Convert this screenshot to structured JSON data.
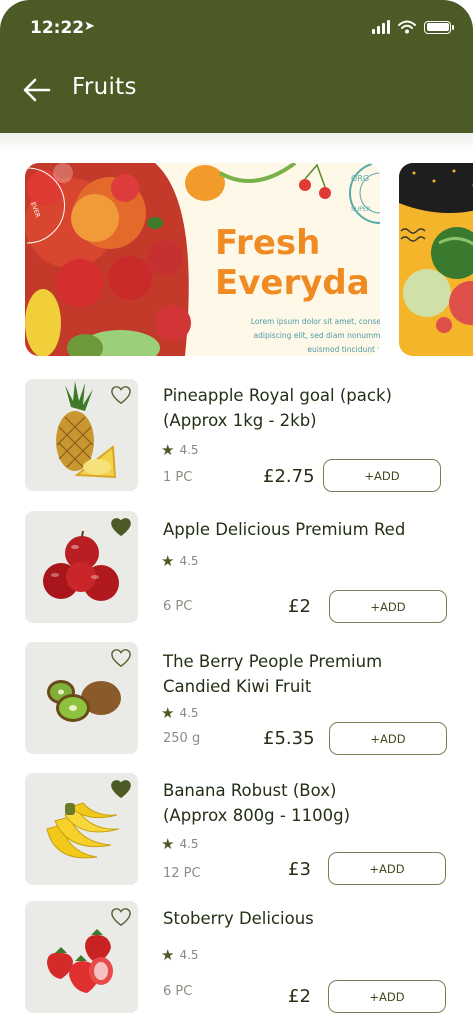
{
  "status_bar": {
    "time": "12:22"
  },
  "header": {
    "title": "Fruits"
  },
  "banner": {
    "headline": "Fresh\nEveryda",
    "copy": "Lorem ipsum dolor sit amet, consec\nadipiscing elit, sed diam nonummy\neuismod tincidunt ut",
    "badge_text": "ORG SUPER",
    "side_badge": "EVER"
  },
  "products": [
    {
      "name": "Pineapple Royal goal (pack)\n(Approx 1kg - 2kb)",
      "rating": "4.5",
      "unit": "1 PC",
      "price": "£2.75",
      "add_label": "+ADD",
      "favorite": false
    },
    {
      "name": "Apple Delicious Premium Red",
      "rating": "4.5",
      "unit": "6 PC",
      "price": "£2",
      "add_label": "+ADD",
      "favorite": true
    },
    {
      "name": "The Berry People Premium\nCandied Kiwi Fruit",
      "rating": "4.5",
      "unit": "250 g",
      "price": "£5.35",
      "add_label": "+ADD",
      "favorite": false
    },
    {
      "name": "Banana Robust (Box)\n(Approx 800g - 1100g)",
      "rating": "4.5",
      "unit": "12 PC",
      "price": "£3",
      "add_label": "+ADD",
      "favorite": true
    },
    {
      "name": "Stoberry Delicious",
      "rating": "4.5",
      "unit": "6 PC",
      "price": "£2",
      "add_label": "+ADD",
      "favorite": false
    }
  ],
  "colors": {
    "header": "#4c5a26",
    "accent": "#f08a22",
    "thumb_bg": "#eaebe6"
  }
}
